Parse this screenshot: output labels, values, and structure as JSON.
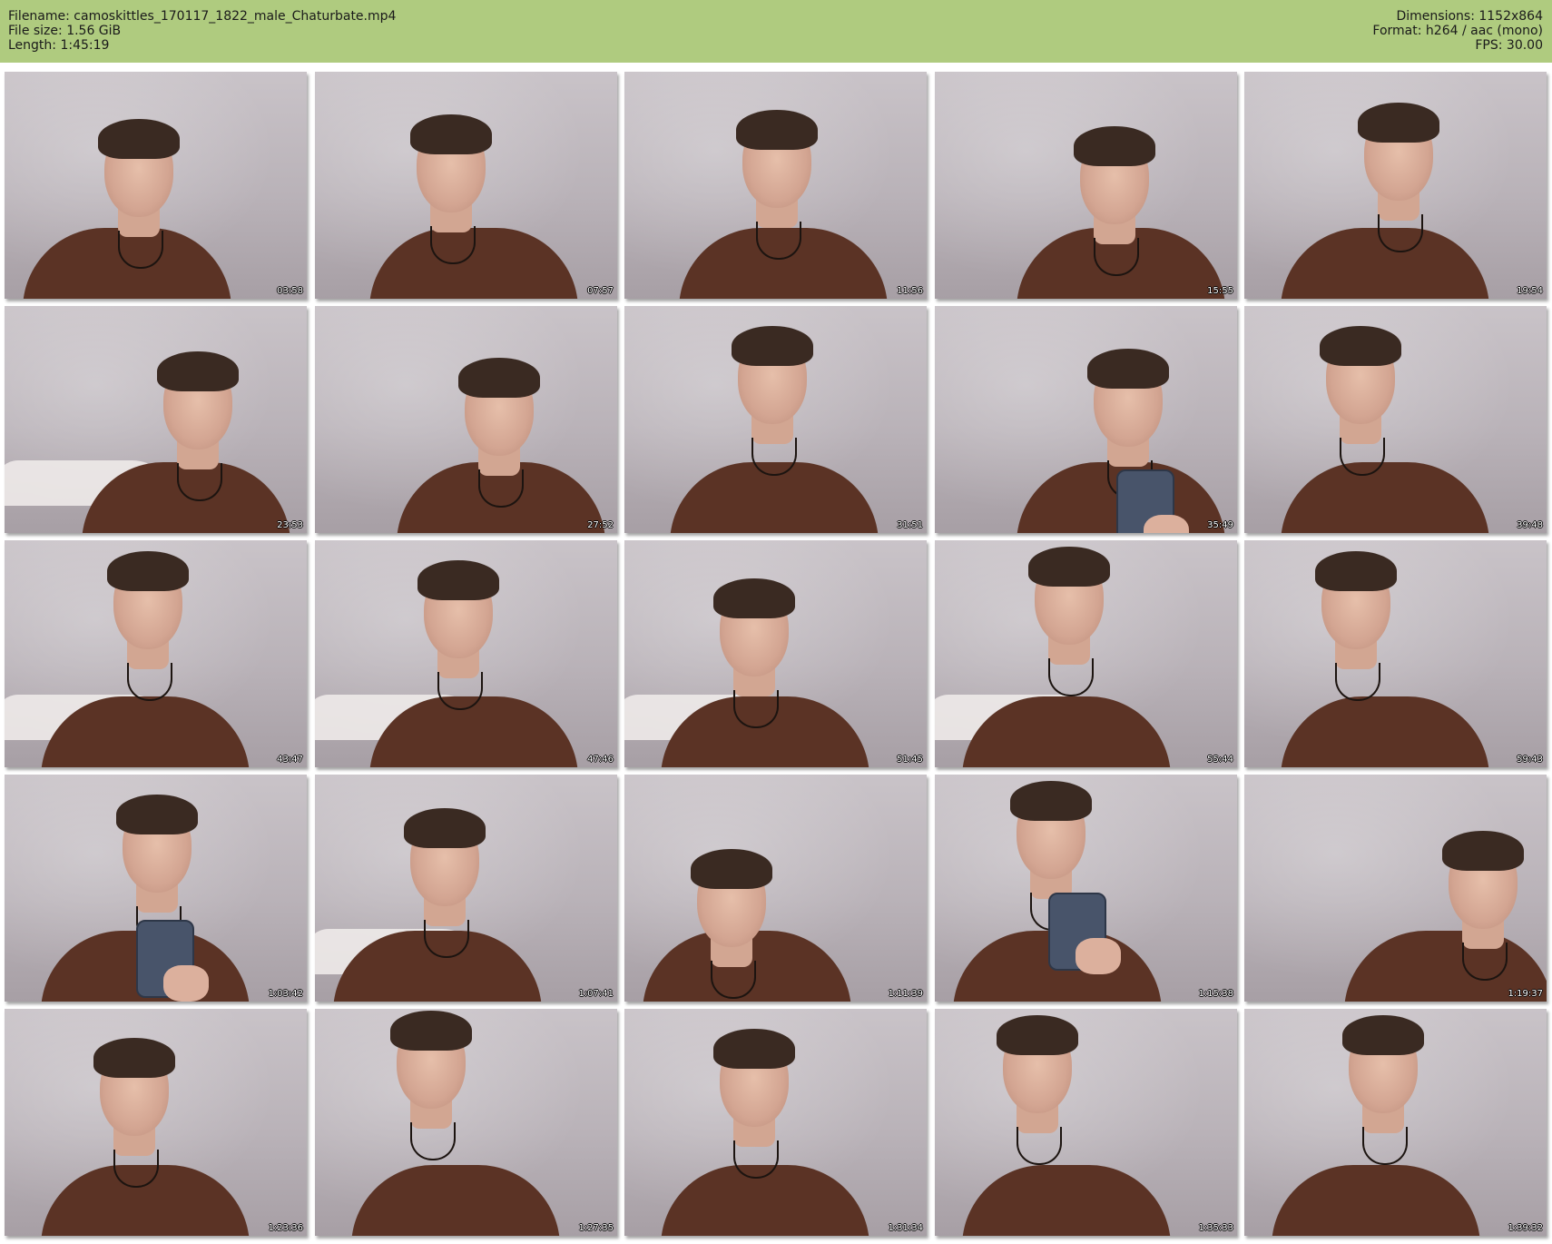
{
  "header": {
    "filename_line": "Filename: camoskittles_170117_1822_male_Chaturbate.mp4",
    "filesize_line": "File size: 1.56 GiB",
    "length_line": "Length: 1:45:19",
    "dimensions_line": "Dimensions: 1152x864",
    "format_line": "Format: h264 / aac (mono)",
    "fps_line": "FPS: 30.00",
    "background_color": "#afcb7f"
  },
  "thumbnails": [
    {
      "timestamp": "03:58"
    },
    {
      "timestamp": "07:57"
    },
    {
      "timestamp": "11:56"
    },
    {
      "timestamp": "15:55"
    },
    {
      "timestamp": "19:54"
    },
    {
      "timestamp": "23:53"
    },
    {
      "timestamp": "27:52"
    },
    {
      "timestamp": "31:51"
    },
    {
      "timestamp": "35:49"
    },
    {
      "timestamp": "39:48"
    },
    {
      "timestamp": "43:47"
    },
    {
      "timestamp": "47:46"
    },
    {
      "timestamp": "51:45"
    },
    {
      "timestamp": "55:44"
    },
    {
      "timestamp": "59:43"
    },
    {
      "timestamp": "1:03:42"
    },
    {
      "timestamp": "1:07:41"
    },
    {
      "timestamp": "1:11:39"
    },
    {
      "timestamp": "1:15:38"
    },
    {
      "timestamp": "1:19:37"
    },
    {
      "timestamp": "1:23:36"
    },
    {
      "timestamp": "1:27:35"
    },
    {
      "timestamp": "1:31:34"
    },
    {
      "timestamp": "1:35:33"
    },
    {
      "timestamp": "1:39:32"
    }
  ]
}
